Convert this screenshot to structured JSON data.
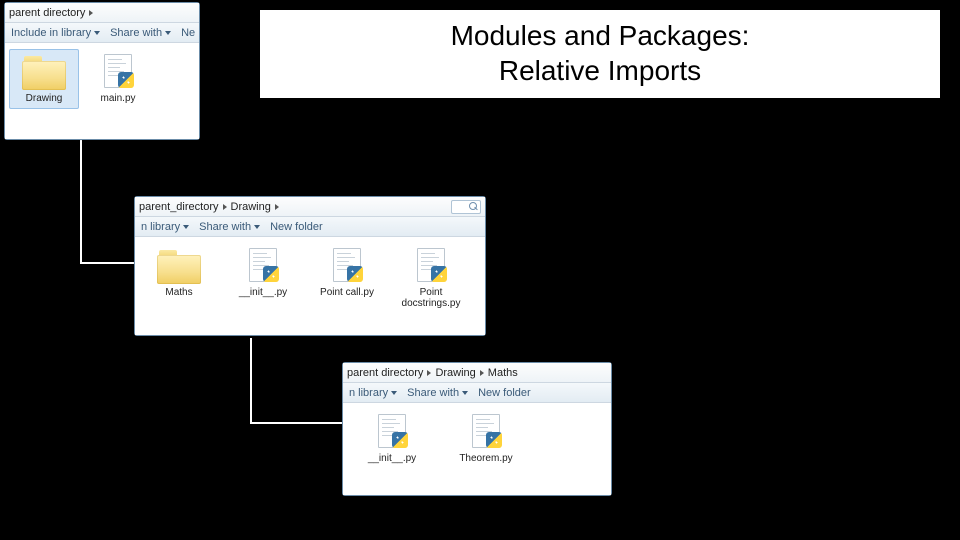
{
  "title_line1": "Modules and Packages:",
  "title_line2": "Relative Imports",
  "windows": {
    "w1": {
      "crumbs": [
        "parent directory"
      ],
      "toolbar": {
        "include": "Include in library",
        "share": "Share with",
        "newf": "Ne"
      },
      "items": [
        {
          "name": "Drawing",
          "kind": "folder",
          "selected": true
        },
        {
          "name": "main.py",
          "kind": "py",
          "selected": false
        }
      ]
    },
    "w2": {
      "crumbs": [
        "parent_directory",
        "Drawing"
      ],
      "toolbar": {
        "include": "n library",
        "share": "Share with",
        "newf": "New folder"
      },
      "items": [
        {
          "name": "Maths",
          "kind": "folder",
          "selected": false
        },
        {
          "name": "__init__.py",
          "kind": "py",
          "selected": false
        },
        {
          "name": "Point call.py",
          "kind": "py",
          "selected": false
        },
        {
          "name": "Point docstrings.py",
          "kind": "py",
          "selected": false
        }
      ]
    },
    "w3": {
      "crumbs": [
        "parent directory",
        "Drawing",
        "Maths"
      ],
      "toolbar": {
        "include": "n library",
        "share": "Share with",
        "newf": "New folder"
      },
      "items": [
        {
          "name": "__init__.py",
          "kind": "py",
          "selected": false
        },
        {
          "name": "Theorem.py",
          "kind": "py",
          "selected": false
        }
      ]
    }
  }
}
